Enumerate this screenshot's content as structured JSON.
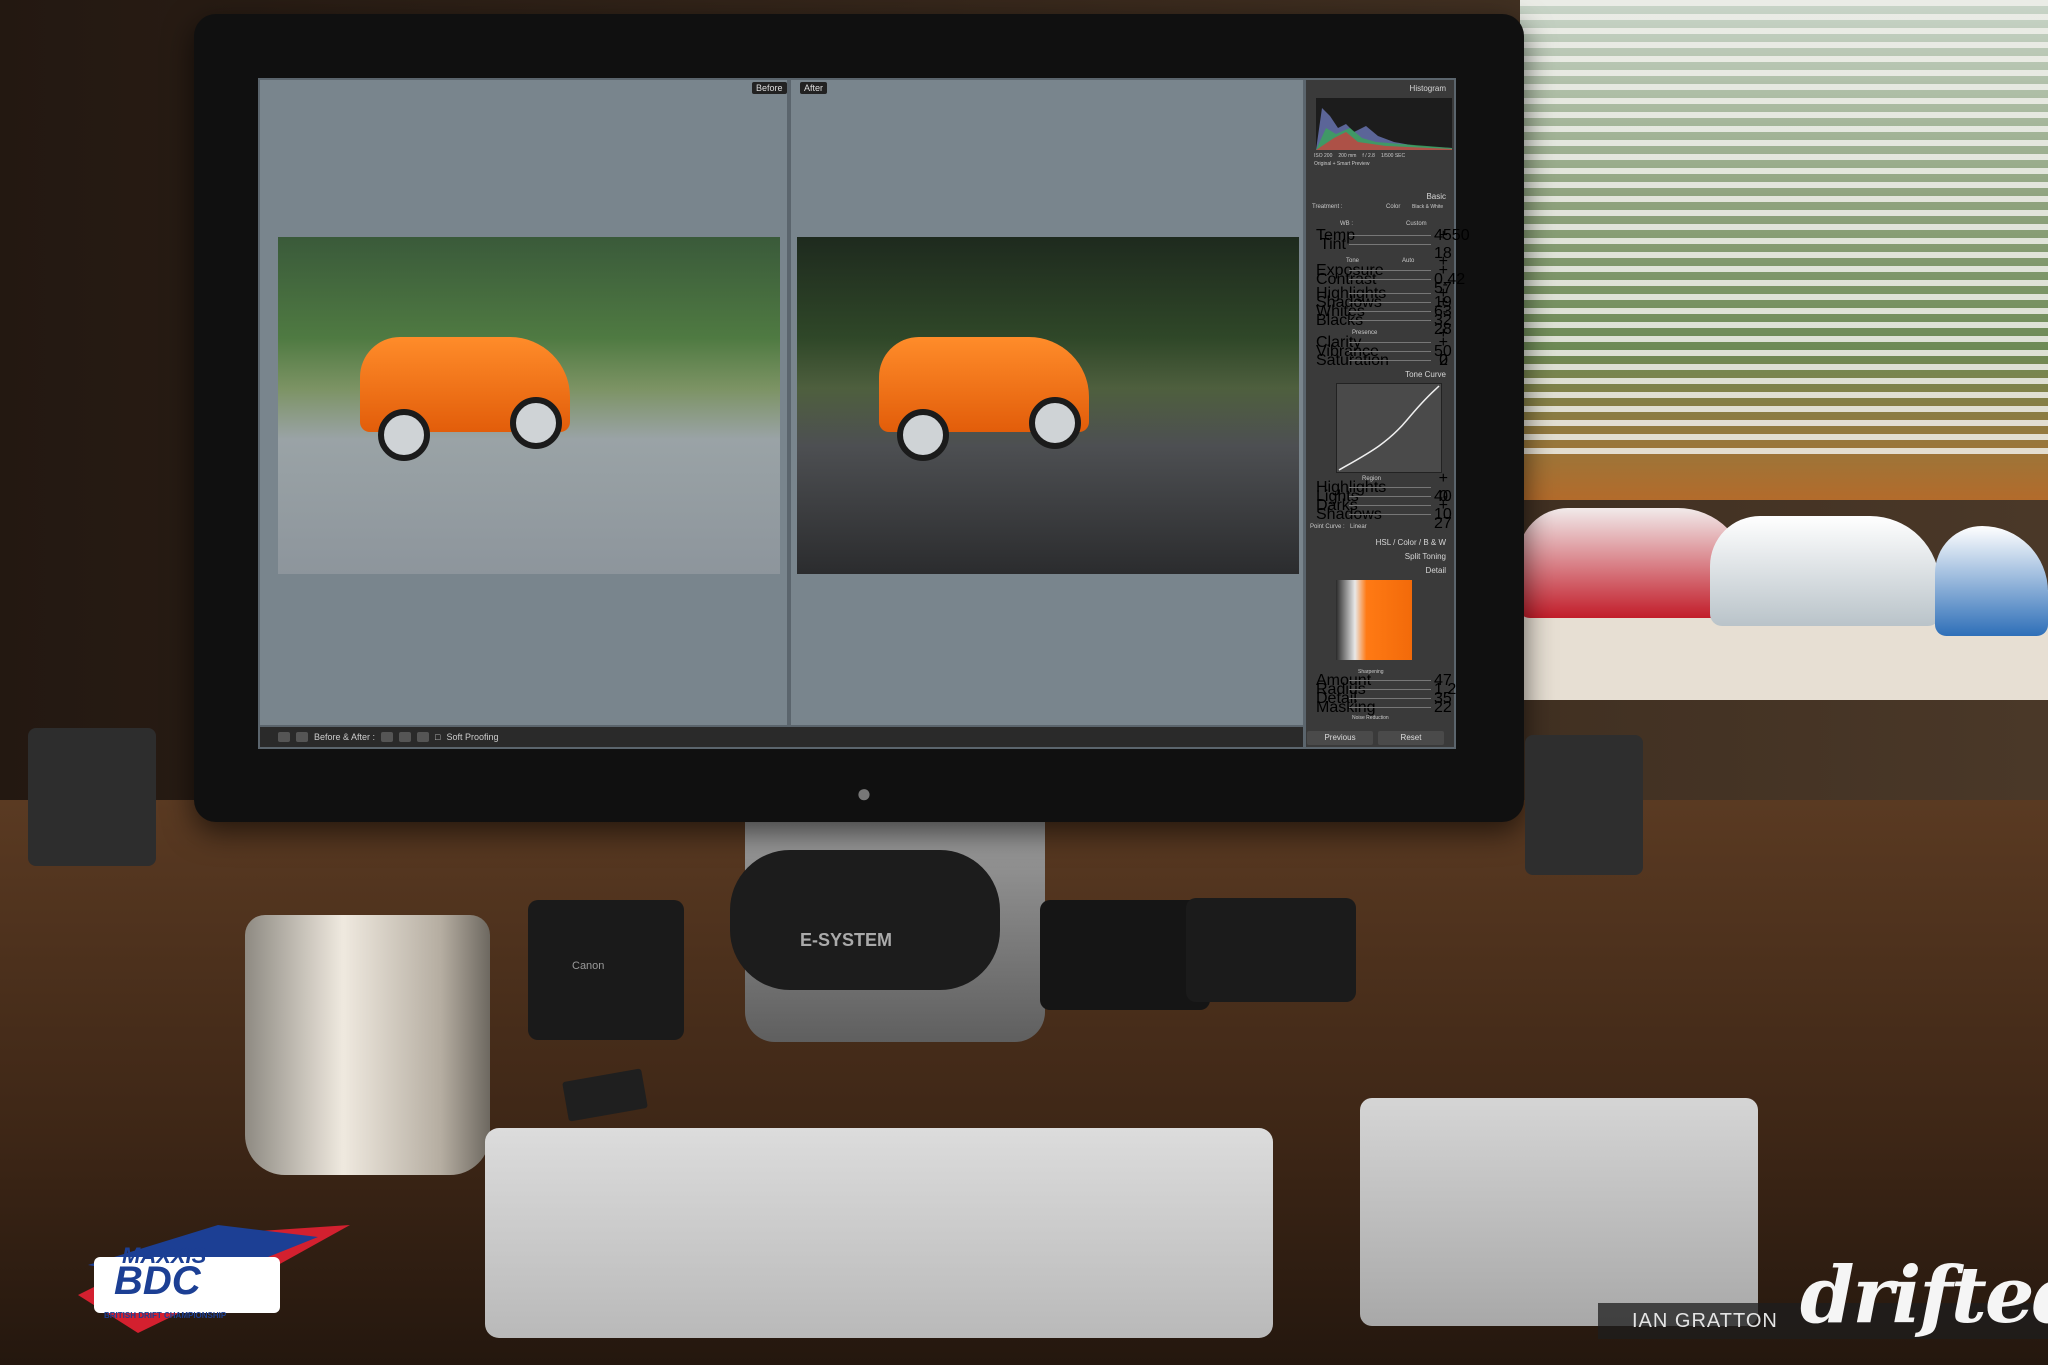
{
  "lightroom": {
    "compare_labels": {
      "before": "Before",
      "after": "After"
    },
    "toolbar": {
      "before_after_label": "Before & After :",
      "soft_proofing_label": "Soft Proofing"
    },
    "panel": {
      "histogram_title": "Histogram",
      "histogram_info": [
        "ISO 200",
        "200 mm",
        "f / 2.8",
        "1/500 SEC"
      ],
      "preview_label": "Original + Smart Preview",
      "basic_title": "Basic",
      "treatment_label": "Treatment :",
      "treatment_options": [
        "Color",
        "Black & White"
      ],
      "wb_label": "WB :",
      "wb_value": "Custom",
      "tone_label": "Tone",
      "auto_label": "Auto",
      "presence_label": "Presence",
      "sliders": [
        {
          "label": "Temp",
          "value": "4550"
        },
        {
          "label": "Tint",
          "value": "+ 18"
        },
        {
          "label": "Exposure",
          "value": "+ 0.42"
        },
        {
          "label": "Contrast",
          "value": "+ 57"
        },
        {
          "label": "Highlights",
          "value": "- 19"
        },
        {
          "label": "Shadows",
          "value": "+ 63"
        },
        {
          "label": "Whites",
          "value": "+ 32"
        },
        {
          "label": "Blacks",
          "value": "- 28"
        },
        {
          "label": "Clarity",
          "value": "+ 50"
        },
        {
          "label": "Vibrance",
          "value": "+ 2"
        },
        {
          "label": "Saturation",
          "value": "0"
        }
      ],
      "tone_curve_title": "Tone Curve",
      "region_label": "Region",
      "region_sliders": [
        {
          "label": "Highlights",
          "value": "+ 40"
        },
        {
          "label": "Lights",
          "value": "0"
        },
        {
          "label": "Darks",
          "value": "- 10"
        },
        {
          "label": "Shadows",
          "value": "+ 27"
        }
      ],
      "point_curve_label": "Point Curve :",
      "point_curve_value": "Linear",
      "hsl_label": "HSL / Color / B & W",
      "split_toning_title": "Split Toning",
      "detail_title": "Detail",
      "sharpening_label": "Sharpening",
      "sharpening_sliders": [
        {
          "label": "Amount",
          "value": "47"
        },
        {
          "label": "Radius",
          "value": "1.2"
        },
        {
          "label": "Detail",
          "value": "35"
        },
        {
          "label": "Masking",
          "value": "22"
        }
      ],
      "noise_reduction_label": "Noise Reduction",
      "previous_button": "Previous",
      "reset_button": "Reset"
    }
  },
  "desk_labels": {
    "pouch_brand": "E-SYSTEM",
    "charger_brand": "Canon"
  },
  "branding": {
    "bdc_top": "MAXXIS",
    "bdc_main": "BDC",
    "bdc_sub": "BRITISH DRIFT CHAMPIONSHIP",
    "photographer": "IAN GRATTON",
    "site_logo": "drifted"
  },
  "colors": {
    "car_orange": "#f26a0a",
    "bdc_blue": "#1c3f94",
    "bdc_red": "#d3202f"
  }
}
